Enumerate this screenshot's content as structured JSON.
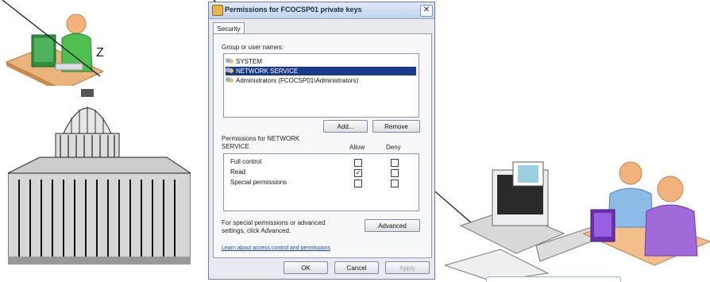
{
  "dialog": {
    "title": "Permissions for FCOCSP01 private keys",
    "close_glyph": "✕",
    "tab": "Security",
    "group_label": "Group or user names:",
    "users": [
      {
        "name": "SYSTEM",
        "selected": false
      },
      {
        "name": "NETWORK SERVICE",
        "selected": true
      },
      {
        "name": "Administrators (FCOCSP01\\Administrators)",
        "selected": false
      }
    ],
    "add_label": "Add...",
    "remove_label": "Remove",
    "perm_header": "Permissions for NETWORK SERVICE",
    "allow_label": "Allow",
    "deny_label": "Deny",
    "permissions": [
      {
        "name": "Full control",
        "allow": false,
        "deny": false
      },
      {
        "name": "Read",
        "allow": true,
        "deny": false
      },
      {
        "name": "Special permissions",
        "allow": false,
        "deny": false
      }
    ],
    "advanced_text": "For special permissions or advanced settings, click Advanced.",
    "advanced_label": "Advanced",
    "learn_link": "Learn about access control and permissions",
    "ok_label": "OK",
    "cancel_label": "Cancel",
    "apply_label": "Apply"
  },
  "illustration": {
    "z_text": "Z",
    "figures": [
      "admin-at-desk-icon",
      "capitol-building-icon",
      "computer-workstation-icon",
      "two-users-icon"
    ]
  }
}
